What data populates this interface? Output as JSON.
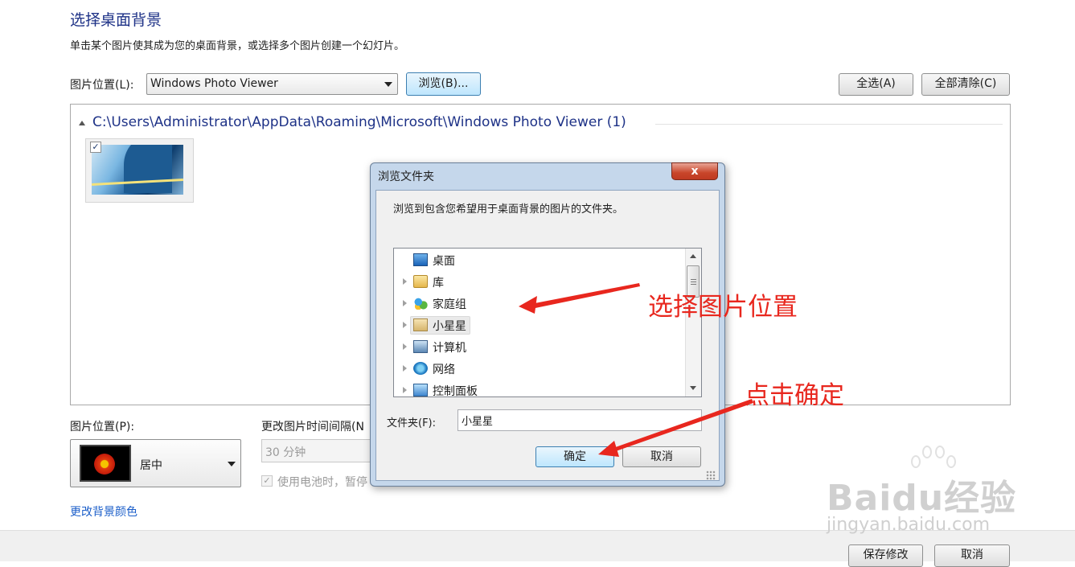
{
  "page": {
    "title": "选择桌面背景",
    "subtitle": "单击某个图片使其成为您的桌面背景，或选择多个图片创建一个幻灯片。"
  },
  "location": {
    "label": "图片位置(L):",
    "value": "Windows Photo Viewer",
    "browse_label": "浏览(B)...",
    "select_all_label": "全选(A)",
    "clear_all_label": "全部清除(C)"
  },
  "picture_list": {
    "group_header": "C:\\Users\\Administrator\\AppData\\Roaming\\Microsoft\\Windows Photo Viewer (1)",
    "thumbnail_checked": "✓"
  },
  "position": {
    "label": "图片位置(P):",
    "value": "居中"
  },
  "interval": {
    "label": "更改图片时间间隔(N",
    "value": "30 分钟",
    "battery_label": "使用电池时，暂停",
    "battery_checked": "✓"
  },
  "change_color_link": "更改背景颜色",
  "footer": {
    "save_label": "保存修改",
    "cancel_label": "取消"
  },
  "dialog": {
    "title": "浏览文件夹",
    "close_glyph": "x",
    "description": "浏览到包含您希望用于桌面背景的图片的文件夹。",
    "tree": [
      {
        "label": "桌面",
        "icon": "desktop-icon",
        "expandable": false,
        "selected": false
      },
      {
        "label": "库",
        "icon": "library-icon",
        "expandable": true,
        "selected": false
      },
      {
        "label": "家庭组",
        "icon": "homegroup-icon",
        "expandable": true,
        "selected": false
      },
      {
        "label": "小星星",
        "icon": "user-folder-icon",
        "expandable": true,
        "selected": true
      },
      {
        "label": "计算机",
        "icon": "computer-icon",
        "expandable": true,
        "selected": false
      },
      {
        "label": "网络",
        "icon": "network-icon",
        "expandable": true,
        "selected": false
      },
      {
        "label": "控制面板",
        "icon": "control-panel-icon",
        "expandable": true,
        "selected": false
      }
    ],
    "folder_label": "文件夹(F):",
    "folder_value": "小星星",
    "ok_label": "确定",
    "cancel_label": "取消"
  },
  "annotations": {
    "select_location": "选择图片位置",
    "click_ok": "点击确定",
    "color": "#e8271e"
  },
  "watermark": {
    "logo": "Baidu经验",
    "site": "jingyan.baidu.com"
  },
  "colors": {
    "heading": "#1e3287",
    "link": "#1b5ec9",
    "dialog_frame": "#c5d7eb",
    "close_button": "#c8452a"
  }
}
